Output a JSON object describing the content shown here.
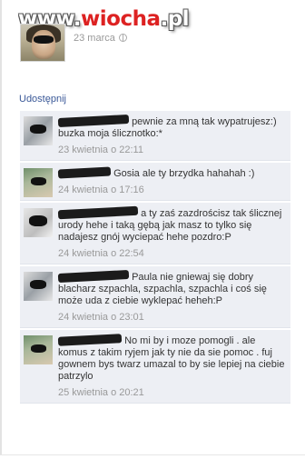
{
  "watermark": {
    "text_prefix": "www.",
    "text_accent": "wiocha",
    "text_suffix": ".pl"
  },
  "post": {
    "date": "23 marca",
    "visibility_icon": "globe-icon"
  },
  "actions": {
    "share": "Udostępnij"
  },
  "comments": [
    {
      "text": "pewnie za mną tak wypatrujesz:) buzka moja ślicznotko:*",
      "time": "23 kwietnia o 22:11"
    },
    {
      "text": "Gosia ale ty brzydka hahahah :)",
      "time": "24 kwietnia o 17:16"
    },
    {
      "text": "a ty zaś zazdrościsz tak ślicznej urody hehe i taką gębą jak masz to tylko się nadajesz gnój wyciepać hehe pozdro:P",
      "time": "24 kwietnia o 22:54"
    },
    {
      "text": "Paula nie gniewaj się dobry blacharz szpachla, szpachla, szpachla i coś się może uda z ciebie wyklepać heheh:P",
      "time": "24 kwietnia o 23:01"
    },
    {
      "text": "No mi by i moze pomogli . ale komus z takim ryjem jak ty nie da sie pomoc . fuj gownem bys twarz umazal to by sie lepiej na ciebie patrzylo",
      "time": "25 kwietnia o 20:21"
    }
  ],
  "colors": {
    "link": "#3b5998",
    "comment_bg": "#edeff4",
    "meta_text": "#999999",
    "body_text": "#333333"
  }
}
